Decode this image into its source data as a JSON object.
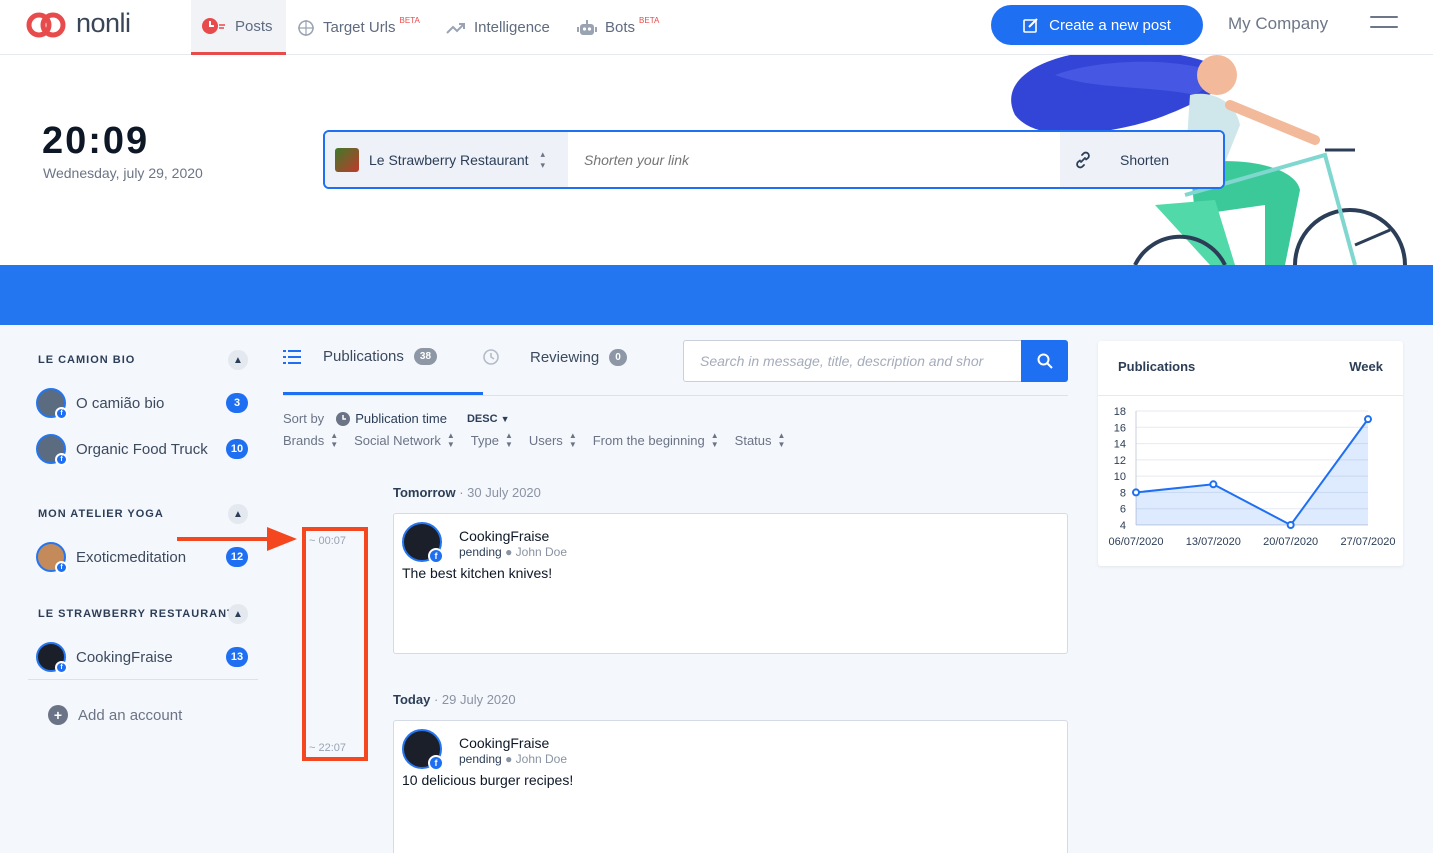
{
  "brand": {
    "name": "nonli"
  },
  "nav": {
    "posts": "Posts",
    "target_urls": "Target Urls",
    "target_urls_badge": "BETA",
    "intelligence": "Intelligence",
    "bots": "Bots",
    "bots_badge": "BETA",
    "create_post": "Create a new post",
    "company": "My Company"
  },
  "header": {
    "time": "20:09",
    "date": "Wednesday, july 29, 2020",
    "selected_brand": "Le Strawberry Restaurant",
    "link_placeholder": "Shorten your link",
    "shorten_label": "Shorten"
  },
  "sidebar": {
    "groups": [
      {
        "title": "LE CAMION BIO",
        "accounts": [
          {
            "name": "O camião bio",
            "count": "3"
          },
          {
            "name": "Organic Food Truck",
            "count": "10"
          }
        ]
      },
      {
        "title": "MON ATELIER YOGA",
        "accounts": [
          {
            "name": "Exoticmeditation",
            "count": "12"
          }
        ]
      },
      {
        "title": "LE STRAWBERRY RESTAURANT",
        "accounts": [
          {
            "name": "CookingFraise",
            "count": "13"
          }
        ]
      }
    ],
    "add_account": "Add an account"
  },
  "tabs": {
    "publications": "Publications",
    "publications_count": "38",
    "reviewing": "Reviewing",
    "reviewing_count": "0"
  },
  "search": {
    "placeholder": "Search in message, title, description and shor"
  },
  "sort": {
    "label": "Sort by",
    "field": "Publication time",
    "order": "DESC"
  },
  "filters": [
    "Brands",
    "Social Network",
    "Type",
    "Users",
    "From the beginning",
    "Status"
  ],
  "timeline": {
    "start": "00:07",
    "end": "22:07"
  },
  "days": [
    {
      "label": "Tomorrow",
      "date": "30 July 2020",
      "post": {
        "account": "CookingFraise",
        "status": "pending",
        "user": "John Doe",
        "message": "The best kitchen knives!"
      }
    },
    {
      "label": "Today",
      "date": "29 July 2020",
      "post": {
        "account": "CookingFraise",
        "status": "pending",
        "user": "John Doe",
        "message": "10 delicious burger recipes!"
      }
    }
  ],
  "stats": {
    "title": "Publications",
    "period": "Week"
  },
  "colors": {
    "primary": "#1f6ff2",
    "accent_red": "#f4471f",
    "band": "#2476f0"
  },
  "chart_data": {
    "type": "area",
    "categories": [
      "06/07/2020",
      "13/07/2020",
      "20/07/2020",
      "27/07/2020"
    ],
    "values": [
      8,
      9,
      4,
      17
    ],
    "ylim": [
      4,
      18
    ],
    "yticks": [
      4,
      6,
      8,
      10,
      12,
      14,
      16,
      18
    ],
    "grid": true
  }
}
